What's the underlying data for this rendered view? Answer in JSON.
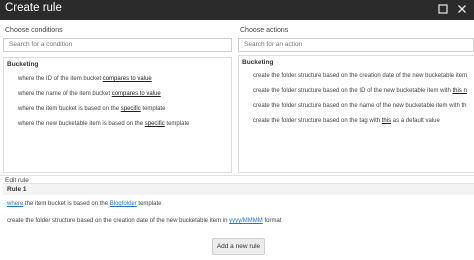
{
  "window": {
    "title": "Create rule"
  },
  "conditions": {
    "label": "Choose conditions",
    "search_placeholder": "Search for a condition",
    "group": "Bucketing",
    "items": [
      {
        "pre": "where the ID of the item bucket ",
        "link": "compares to value",
        "post": ""
      },
      {
        "pre": "where the name of the item bucket ",
        "link": "compares to value",
        "post": ""
      },
      {
        "pre": "where the item bucket is based on the ",
        "link": "specific",
        "post": " template"
      },
      {
        "pre": "where the new bucketable item is based on the ",
        "link": "specific",
        "post": " template"
      }
    ]
  },
  "actions": {
    "label": "Choose actions",
    "search_placeholder": "Search for an action",
    "group": "Bucketing",
    "items": [
      {
        "pre": "create the folder structure based on the creation date of the new bucketable item",
        "link": "",
        "post": ""
      },
      {
        "pre": "create the folder structure based on the ID of the new bucketable item with ",
        "link": "this n",
        "post": ""
      },
      {
        "pre": "create the folder structure based on the name of the new bucketable item with th",
        "link": "",
        "post": ""
      },
      {
        "pre": "create the folder structure based on the tag with ",
        "link": "this",
        "post": " as a default value"
      }
    ]
  },
  "edit": {
    "label": "Edit rule",
    "rule_title": "Rule 1",
    "condition": {
      "link1": "where",
      "mid": " the item bucket is based on the ",
      "link2": "Blogfolder",
      "post": " template"
    },
    "action": {
      "pre": "create the folder structure based on the creation date of the new bucketable item in ",
      "link": "yyyy/MMMM",
      "post": " format"
    },
    "add_button": "Add a new rule"
  }
}
